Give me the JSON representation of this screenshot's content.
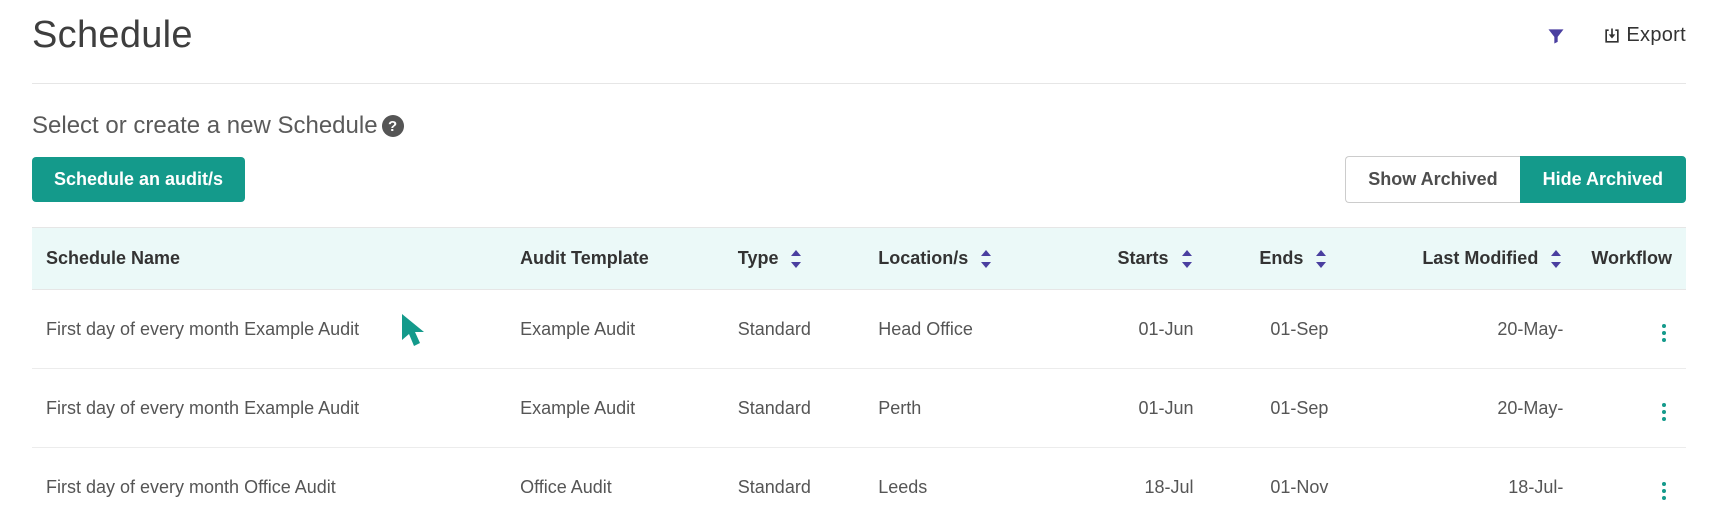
{
  "header": {
    "title": "Schedule",
    "export_label": "Export"
  },
  "subheading": "Select or create a new Schedule",
  "actions": {
    "schedule_button": "Schedule an audit/s",
    "show_archived": "Show Archived",
    "hide_archived": "Hide Archived"
  },
  "columns": {
    "schedule_name": "Schedule Name",
    "audit_template": "Audit Template",
    "type": "Type",
    "locations": "Location/s",
    "starts": "Starts",
    "ends": "Ends",
    "last_modified": "Last Modified",
    "workflow": "Workflow"
  },
  "rows": [
    {
      "schedule_name": "First day of every month Example Audit",
      "audit_template": "Example Audit",
      "type": "Standard",
      "locations": "Head Office",
      "starts": "01-Jun",
      "ends": "01-Sep",
      "last_modified": "20-May-"
    },
    {
      "schedule_name": "First day of every month Example Audit",
      "audit_template": "Example Audit",
      "type": "Standard",
      "locations": "Perth",
      "starts": "01-Jun",
      "ends": "01-Sep",
      "last_modified": "20-May-"
    },
    {
      "schedule_name": "First day of every month Office Audit",
      "audit_template": "Office Audit",
      "type": "Standard",
      "locations": "Leeds",
      "starts": "18-Jul",
      "ends": "01-Nov",
      "last_modified": "18-Jul-"
    }
  ]
}
